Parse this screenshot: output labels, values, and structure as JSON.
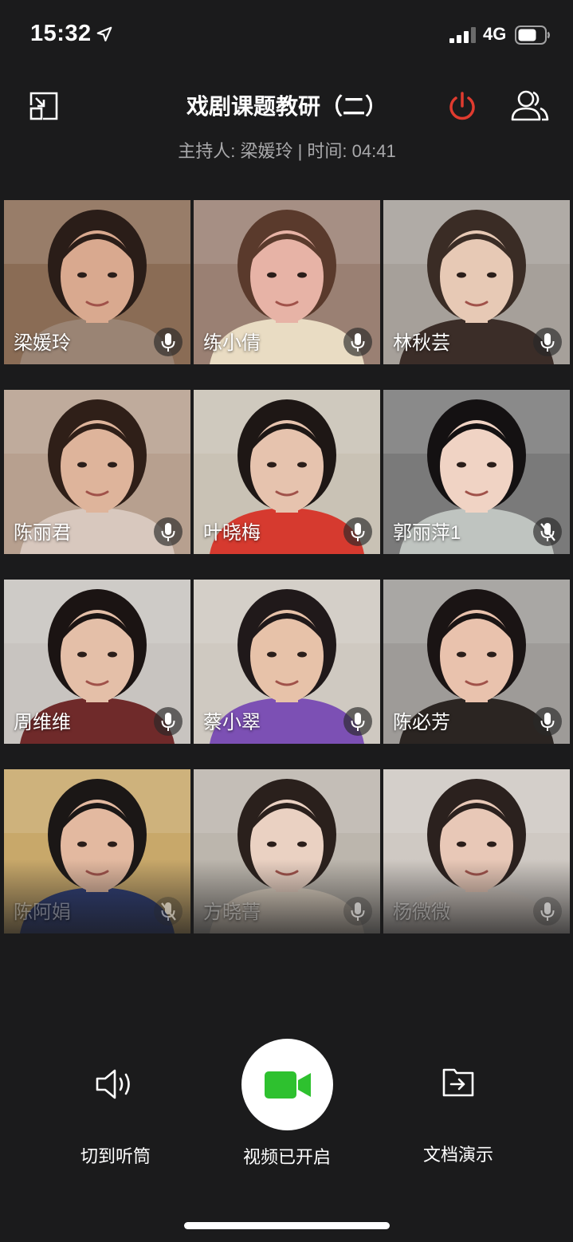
{
  "status": {
    "time": "15:32",
    "network": "4G"
  },
  "header": {
    "title": "戏剧课题教研（二）",
    "subtitle": "主持人: 梁媛玲 | 时间: 04:41",
    "colors": {
      "power": "#e03b2f"
    }
  },
  "participants": [
    {
      "name": "梁媛玲",
      "mic": "on",
      "bg": "#8a6c55",
      "skin": "#d9a98f",
      "hair": "#2a1d18",
      "shirt": "#9a8474"
    },
    {
      "name": "练小倩",
      "mic": "on",
      "bg": "#9a8073",
      "skin": "#e7b3a6",
      "hair": "#5a3a2c",
      "shirt": "#e9dcc3"
    },
    {
      "name": "林秋芸",
      "mic": "on",
      "bg": "#a6a09a",
      "skin": "#e7c9b5",
      "hair": "#3a2c25",
      "shirt": "#3b2d28"
    },
    {
      "name": "陈丽君",
      "mic": "on",
      "bg": "#b7a08f",
      "skin": "#deb49b",
      "hair": "#2f1f18",
      "shirt": "#d8c8be"
    },
    {
      "name": "叶晓梅",
      "mic": "on",
      "bg": "#c9c2b5",
      "skin": "#e6c3ae",
      "hair": "#1e1715",
      "shirt": "#d63a2f"
    },
    {
      "name": "郭丽萍1",
      "mic": "off",
      "bg": "#7a7a7a",
      "skin": "#f0d3c4",
      "hair": "#141112",
      "shirt": "#bfc4c0"
    },
    {
      "name": "周维维",
      "mic": "on",
      "bg": "#c8c4c0",
      "skin": "#e4bfa8",
      "hair": "#1b1413",
      "shirt": "#6f2a2a"
    },
    {
      "name": "蔡小翠",
      "mic": "on",
      "bg": "#cfc9c1",
      "skin": "#e7c2a9",
      "hair": "#20191a",
      "shirt": "#7c50b4"
    },
    {
      "name": "陈必芳",
      "mic": "on",
      "bg": "#9e9b98",
      "skin": "#e9c2ad",
      "hair": "#1a1414",
      "shirt": "#2b2522"
    },
    {
      "name": "陈阿娟",
      "mic": "off",
      "bg": "#c8a86a",
      "skin": "#e3b9a0",
      "hair": "#1b1716",
      "shirt": "#2d3d78"
    },
    {
      "name": "方晓菁",
      "mic": "on",
      "bg": "#bcb6ad",
      "skin": "#ead1c2",
      "hair": "#2a201c",
      "shirt": "#e5d8c7"
    },
    {
      "name": "杨微微",
      "mic": "on",
      "bg": "#cfc9c3",
      "skin": "#e8c8b7",
      "hair": "#2b211e",
      "shirt": "#d2c9c1"
    }
  ],
  "controls": {
    "speaker_label": "切到听筒",
    "video_label": "视频已开启",
    "doc_label": "文档演示",
    "video_color": "#2ec12f"
  }
}
